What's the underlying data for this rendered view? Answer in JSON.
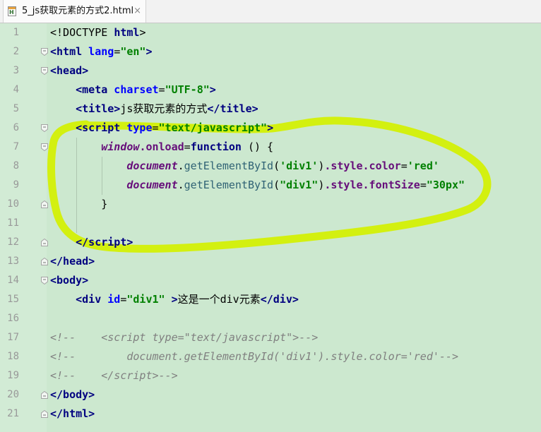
{
  "tab": {
    "icon": "html-file-icon",
    "icon_letter": "H",
    "title": "5_js获取元素的方式2.html",
    "close": "×"
  },
  "colors": {
    "editor_bg": "#cce8cf",
    "gutter_bg": "#d2ebd5",
    "line_number": "#999999",
    "tag": "#000080",
    "attr": "#0000ff",
    "string": "#008000",
    "keyword": "#000080",
    "variable": "#660e7a",
    "property": "#660e7a",
    "method": "#2f6274",
    "comment": "#808080",
    "plain": "#000000",
    "annotation": "#d4f000"
  },
  "editor": {
    "lines": [
      {
        "n": "1",
        "fold": "",
        "tokens": [
          {
            "k": "plain",
            "t": "<!DOCTYPE "
          },
          {
            "k": "tag",
            "t": "html"
          },
          {
            "k": "plain",
            "t": ">"
          }
        ]
      },
      {
        "n": "2",
        "fold": "fold-start-icon",
        "tokens": [
          {
            "k": "tag",
            "t": "<html"
          },
          {
            "k": "attr",
            "t": " lang"
          },
          {
            "k": "plain",
            "t": "="
          },
          {
            "k": "string",
            "t": "\"en\""
          },
          {
            "k": "tag",
            "t": ">"
          }
        ]
      },
      {
        "n": "3",
        "fold": "fold-start-icon",
        "tokens": [
          {
            "k": "tag",
            "t": "<head>"
          }
        ]
      },
      {
        "n": "4",
        "fold": "",
        "tokens": [
          {
            "k": "tag",
            "t": "    <meta"
          },
          {
            "k": "attr",
            "t": " charset"
          },
          {
            "k": "plain",
            "t": "="
          },
          {
            "k": "string",
            "t": "\"UTF-8\""
          },
          {
            "k": "tag",
            "t": ">"
          }
        ]
      },
      {
        "n": "5",
        "fold": "",
        "tokens": [
          {
            "k": "tag",
            "t": "    <title>"
          },
          {
            "k": "plain",
            "t": "js获取元素的方式"
          },
          {
            "k": "tag",
            "t": "</title>"
          }
        ]
      },
      {
        "n": "6",
        "fold": "fold-start-icon",
        "tokens": [
          {
            "k": "tag",
            "t": "    <script"
          },
          {
            "k": "attr",
            "t": " type"
          },
          {
            "k": "plain",
            "t": "="
          },
          {
            "k": "string",
            "t": "\"text/javascript\""
          },
          {
            "k": "tag",
            "t": ">"
          }
        ]
      },
      {
        "n": "7",
        "fold": "fold-start-icon",
        "tokens": [
          {
            "k": "variable",
            "t": "        window"
          },
          {
            "k": "property",
            "t": ".onload"
          },
          {
            "k": "plain",
            "t": "="
          },
          {
            "k": "keyword",
            "t": "function"
          },
          {
            "k": "plain",
            "t": " () {"
          }
        ]
      },
      {
        "n": "8",
        "fold": "",
        "tokens": [
          {
            "k": "variable",
            "t": "            document"
          },
          {
            "k": "plain",
            "t": "."
          },
          {
            "k": "method",
            "t": "getElementById"
          },
          {
            "k": "plain",
            "t": "("
          },
          {
            "k": "string",
            "t": "'div1'"
          },
          {
            "k": "plain",
            "t": ")"
          },
          {
            "k": "property",
            "t": ".style.color"
          },
          {
            "k": "plain",
            "t": "="
          },
          {
            "k": "string",
            "t": "'red'"
          }
        ]
      },
      {
        "n": "9",
        "fold": "",
        "tokens": [
          {
            "k": "variable",
            "t": "            document"
          },
          {
            "k": "plain",
            "t": "."
          },
          {
            "k": "method",
            "t": "getElementById"
          },
          {
            "k": "plain",
            "t": "("
          },
          {
            "k": "string",
            "t": "\"div1\""
          },
          {
            "k": "plain",
            "t": ")"
          },
          {
            "k": "property",
            "t": ".style.fontSize"
          },
          {
            "k": "plain",
            "t": "="
          },
          {
            "k": "string",
            "t": "\"30px\""
          }
        ]
      },
      {
        "n": "10",
        "fold": "fold-end-icon",
        "tokens": [
          {
            "k": "plain",
            "t": "        }"
          }
        ]
      },
      {
        "n": "11",
        "fold": "",
        "tokens": []
      },
      {
        "n": "12",
        "fold": "fold-end-icon",
        "tokens": [
          {
            "k": "tag",
            "t": "    </script>"
          }
        ]
      },
      {
        "n": "13",
        "fold": "fold-end-icon",
        "tokens": [
          {
            "k": "tag",
            "t": "</head>"
          }
        ]
      },
      {
        "n": "14",
        "fold": "fold-start-icon",
        "tokens": [
          {
            "k": "tag",
            "t": "<body>"
          }
        ]
      },
      {
        "n": "15",
        "fold": "",
        "tokens": [
          {
            "k": "tag",
            "t": "    <div"
          },
          {
            "k": "attr",
            "t": " id"
          },
          {
            "k": "plain",
            "t": "="
          },
          {
            "k": "string",
            "t": "\"div1\""
          },
          {
            "k": "tag",
            "t": " >"
          },
          {
            "k": "plain",
            "t": "这是一个div元素"
          },
          {
            "k": "tag",
            "t": "</div>"
          }
        ]
      },
      {
        "n": "16",
        "fold": "",
        "tokens": []
      },
      {
        "n": "17",
        "fold": "",
        "tokens": [
          {
            "k": "comment",
            "t": "<!--    <script type=\"text/javascript\">-->"
          }
        ]
      },
      {
        "n": "18",
        "fold": "",
        "tokens": [
          {
            "k": "comment",
            "t": "<!--        document.getElementById('div1').style.color='red'-->"
          }
        ]
      },
      {
        "n": "19",
        "fold": "",
        "tokens": [
          {
            "k": "comment",
            "t": "<!--    </script>-->"
          }
        ]
      },
      {
        "n": "20",
        "fold": "fold-end-icon",
        "tokens": [
          {
            "k": "tag",
            "t": "</body>"
          }
        ]
      },
      {
        "n": "21",
        "fold": "fold-end-icon",
        "tokens": [
          {
            "k": "tag",
            "t": "</html>"
          }
        ]
      }
    ]
  }
}
